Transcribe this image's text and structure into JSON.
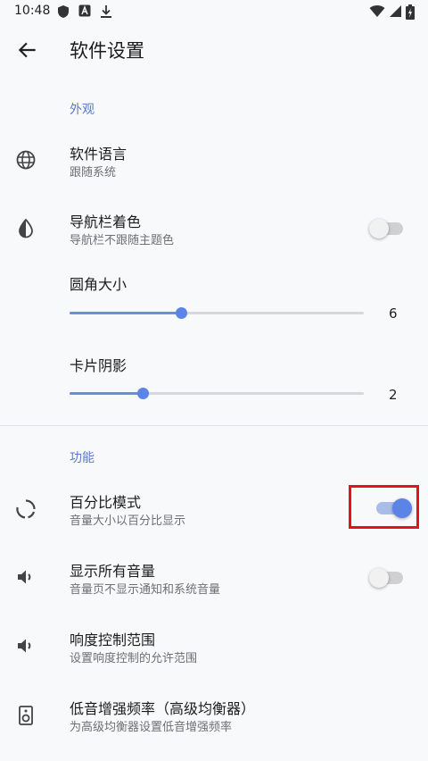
{
  "status_bar": {
    "time": "10:48"
  },
  "app_bar": {
    "title": "软件设置"
  },
  "sections": {
    "appearance": "外观",
    "features": "功能"
  },
  "items": {
    "language": {
      "title": "软件语言",
      "subtitle": "跟随系统"
    },
    "navbar_color": {
      "title": "导航栏着色",
      "subtitle": "导航栏不跟随主题色",
      "enabled": false
    },
    "corner_radius": {
      "title": "圆角大小",
      "value": "6",
      "fraction": 0.378
    },
    "card_shadow": {
      "title": "卡片阴影",
      "value": "2",
      "fraction": 0.248
    },
    "percent_mode": {
      "title": "百分比模式",
      "subtitle": "音量大小以百分比显示",
      "enabled": true
    },
    "show_all_volume": {
      "title": "显示所有音量",
      "subtitle": "音量页不显示通知和系统音量",
      "enabled": false
    },
    "loudness_range": {
      "title": "响度控制范围",
      "subtitle": "设置响度控制的允许范围"
    },
    "bass_boost": {
      "title": "低音增强频率（高级均衡器）",
      "subtitle": "为高级均衡器设置低音增强频率"
    }
  },
  "icons": {
    "shield": "shield-icon",
    "a_box": "a-box-icon",
    "download": "download-icon",
    "wifi": "wifi-icon",
    "signal": "signal-icon",
    "battery": "battery-icon",
    "back": "arrow-back-icon",
    "globe": "globe-icon",
    "contrast": "contrast-icon",
    "percent": "percent-circle-icon",
    "volume": "volume-icon",
    "speaker": "speaker-icon"
  },
  "colors": {
    "accent": "#5b84e6",
    "section": "#5c79c8",
    "highlight": "#e8101a"
  }
}
